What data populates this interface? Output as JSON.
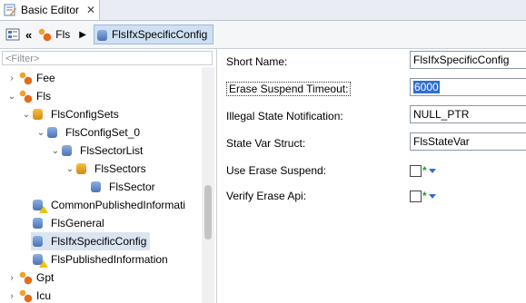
{
  "tab": {
    "title": "Basic Editor",
    "close": "✕"
  },
  "toolbar": {
    "breadcrumb_parent": "Fls",
    "breadcrumb_current": "FlsIfxSpecificConfig"
  },
  "filter": {
    "placeholder": "<Filter>"
  },
  "tree": [
    {
      "label": "Fee",
      "arrow": "›",
      "icon": "module-icon"
    },
    {
      "label": "Fls",
      "arrow": "⌄",
      "icon": "module-icon"
    },
    {
      "label": "FlsConfigSets",
      "arrow": "⌄",
      "icon": "container-icon"
    },
    {
      "label": "FlsConfigSet_0",
      "arrow": "⌄",
      "icon": "container-icon"
    },
    {
      "label": "FlsSectorList",
      "arrow": "⌄",
      "icon": "container-icon"
    },
    {
      "label": "FlsSectors",
      "arrow": "⌄",
      "icon": "container-icon"
    },
    {
      "label": "FlsSector",
      "arrow": "",
      "icon": "container-icon"
    },
    {
      "label": "CommonPublishedInformati",
      "arrow": "",
      "icon": "container-icon"
    },
    {
      "label": "FlsGeneral",
      "arrow": "",
      "icon": "container-icon"
    },
    {
      "label": "FlsIfxSpecificConfig",
      "arrow": "",
      "icon": "container-icon"
    },
    {
      "label": "FlsPublishedInformation",
      "arrow": "",
      "icon": "container-icon"
    },
    {
      "label": "Gpt",
      "arrow": "›",
      "icon": "module-icon"
    },
    {
      "label": "Icu",
      "arrow": "›",
      "icon": "module-icon"
    }
  ],
  "properties": {
    "short_name": {
      "label": "Short Name:",
      "value": "FlsIfxSpecificConfig"
    },
    "erase_suspend_timeout": {
      "label": "Erase Suspend Timeout:",
      "value": "6000"
    },
    "illegal_state_notification": {
      "label": "Illegal State Notification:",
      "value": "NULL_PTR"
    },
    "state_var_struct": {
      "label": "State Var Struct:",
      "value": "FlsStateVar"
    },
    "use_erase_suspend": {
      "label": "Use Erase Suspend:",
      "mark": "*"
    },
    "verify_erase_api": {
      "label": "Verify Erase Api:",
      "mark": "*"
    }
  }
}
